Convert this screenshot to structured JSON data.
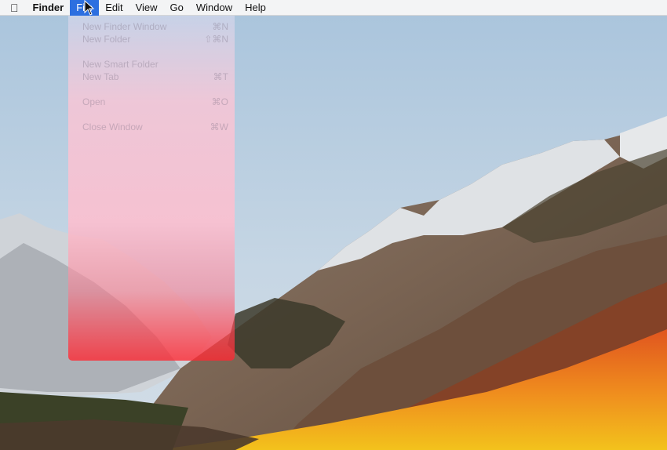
{
  "menubar": {
    "apple_icon": "apple-logo-icon",
    "app_name": "Finder",
    "menus": [
      "File",
      "Edit",
      "View",
      "Go",
      "Window",
      "Help"
    ],
    "active_menu": "File"
  },
  "file_menu": {
    "items": [
      {
        "label": "New Finder Window",
        "shortcut": "⌘N"
      },
      {
        "label": "New Folder",
        "shortcut": "⇧⌘N"
      },
      {
        "label": "New Smart Folder",
        "shortcut": ""
      },
      {
        "label": "New Tab",
        "shortcut": "⌘T"
      },
      {
        "label": "Open",
        "shortcut": "⌘O"
      },
      {
        "label": "Close Window",
        "shortcut": "⌘W"
      }
    ]
  },
  "desktop": {
    "wallpaper": "macOS High Sierra mountain landscape"
  },
  "colors": {
    "menu_highlight": "#2c6fe0",
    "sky": "#b7cde0"
  }
}
